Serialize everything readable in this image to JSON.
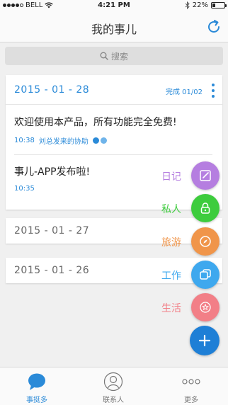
{
  "status_bar": {
    "carrier": "BELL",
    "time": "4:21 PM",
    "battery": "22%",
    "battery_level": 0.22
  },
  "nav": {
    "title": "我的事儿",
    "refresh_icon": "refresh-icon"
  },
  "search": {
    "placeholder": "搜索"
  },
  "main_card": {
    "date": "2015 - 01 - 28",
    "done_label": "完成 01/02",
    "tasks": [
      {
        "title": "欢迎使用本产品，所有功能完全免费!",
        "time": "10:38",
        "assist": "刘总发来的协助"
      },
      {
        "title": "事儿-APP发布啦!",
        "time": "10:35"
      }
    ]
  },
  "date_cards": [
    {
      "date": "2015 - 01 - 27"
    },
    {
      "date": "2015 - 01 - 26"
    }
  ],
  "fab_menu": [
    {
      "label": "日记",
      "color": "#b57ee0",
      "icon": "pencil-icon"
    },
    {
      "label": "私人",
      "color": "#3dcc3d",
      "icon": "lock-icon"
    },
    {
      "label": "旅游",
      "color": "#f0954a",
      "icon": "compass-icon"
    },
    {
      "label": "工作",
      "color": "#3ea8ee",
      "icon": "copy-icon"
    },
    {
      "label": "生活",
      "color": "#f27f87",
      "icon": "star-icon"
    }
  ],
  "fab_add": {
    "color": "#1e7fd6",
    "icon": "plus-icon"
  },
  "tabs": [
    {
      "label": "事挺多",
      "active": true,
      "icon": "chat-bubble-icon"
    },
    {
      "label": "联系人",
      "active": false,
      "icon": "person-icon"
    },
    {
      "label": "更多",
      "active": false,
      "icon": "more-dots-icon"
    }
  ],
  "colors": {
    "accent": "#2a8ad8",
    "inactive": "#777777"
  }
}
